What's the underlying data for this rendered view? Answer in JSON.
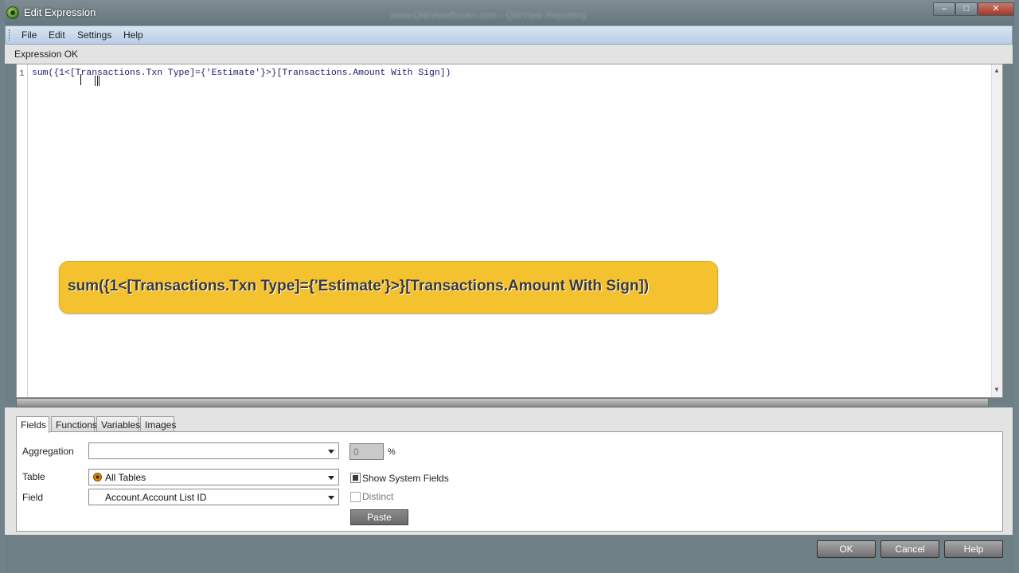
{
  "window": {
    "title": "Edit Expression",
    "background_title": "www.QlikViewBooks.com - QlikView Reporting"
  },
  "menu": {
    "file": "File",
    "edit": "Edit",
    "settings": "Settings",
    "help": "Help"
  },
  "status": "Expression OK",
  "editor": {
    "line_number": "1",
    "code": "sum({1<[Transactions.Txn Type]={'Estimate'}>}[Transactions.Amount With Sign])"
  },
  "callout": {
    "text": "sum({1<[Transactions.Txn Type]={'Estimate'}>}[Transactions.Amount With Sign])",
    "color": "#f4c12f"
  },
  "tabs": [
    "Fields",
    "Functions",
    "Variables",
    "Images"
  ],
  "fields_panel": {
    "aggregation_label": "Aggregation",
    "aggregation_value": "",
    "percent_value": "0",
    "percent_sign": "%",
    "table_label": "Table",
    "table_value": "All Tables",
    "field_label": "Field",
    "field_value": "Account.Account List ID",
    "show_system_fields_label": "Show System Fields",
    "show_system_fields_checked": true,
    "distinct_label": "Distinct",
    "distinct_checked": false,
    "paste_label": "Paste"
  },
  "buttons": {
    "ok": "OK",
    "cancel": "Cancel",
    "help": "Help"
  }
}
